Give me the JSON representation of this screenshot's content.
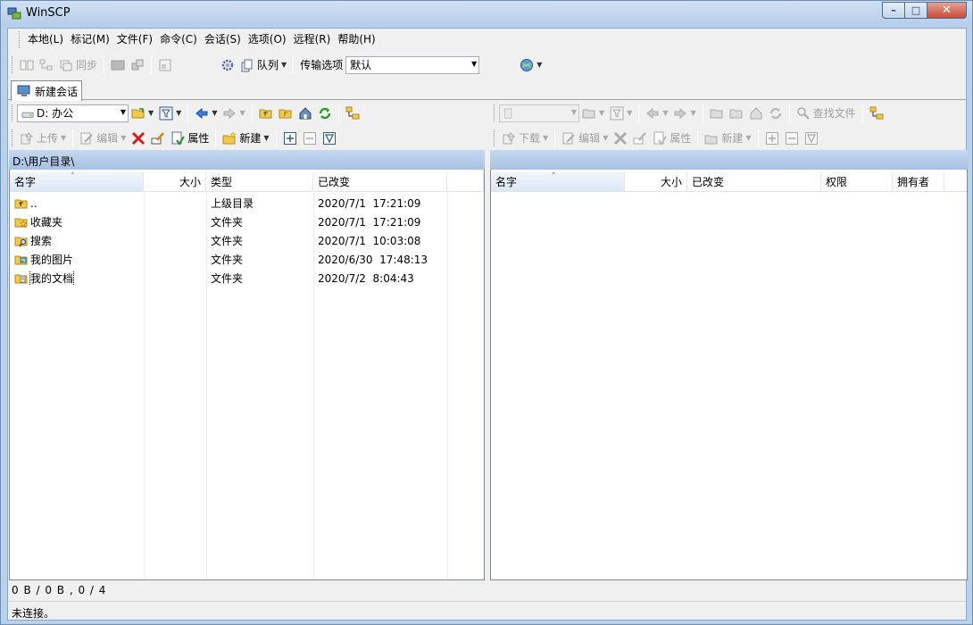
{
  "window": {
    "title": "WinSCP"
  },
  "menu": [
    "本地(L)",
    "标记(M)",
    "文件(F)",
    "命令(C)",
    "会话(S)",
    "选项(O)",
    "远程(R)",
    "帮助(H)"
  ],
  "toolbar1": {
    "sync_label": "同步",
    "queue_label": "队列",
    "transfer_label": "传输选项",
    "transfer_value": "默认"
  },
  "tabs": {
    "new_session": "新建会话"
  },
  "local_nav": {
    "drive": "D: 办公"
  },
  "local_actions": {
    "upload": "上传",
    "edit": "编辑",
    "properties": "属性",
    "new": "新建"
  },
  "remote_nav": {
    "find": "查找文件"
  },
  "remote_actions": {
    "download": "下载",
    "edit": "编辑",
    "properties": "属性",
    "new": "新建"
  },
  "local_panel": {
    "path": "D:\\用户目录\\",
    "columns": {
      "name": "名字",
      "size": "大小",
      "type": "类型",
      "changed": "已改变"
    },
    "rows": [
      {
        "name": "..",
        "type": "上级目录",
        "date": "2020/7/1",
        "time": "17:21:09",
        "icon": "parent-dir-icon"
      },
      {
        "name": "收藏夹",
        "type": "文件夹",
        "date": "2020/7/1",
        "time": "17:21:09",
        "icon": "favorites-folder-icon"
      },
      {
        "name": "搜索",
        "type": "文件夹",
        "date": "2020/7/1",
        "time": "10:03:08",
        "icon": "search-folder-icon"
      },
      {
        "name": "我的图片",
        "type": "文件夹",
        "date": "2020/6/30",
        "time": "17:48:13",
        "icon": "pictures-folder-icon"
      },
      {
        "name": "我的文档",
        "type": "文件夹",
        "date": "2020/7/2",
        "time": "8:04:43",
        "icon": "documents-folder-icon"
      }
    ]
  },
  "remote_panel": {
    "columns": {
      "name": "名字",
      "size": "大小",
      "changed": "已改变",
      "rights": "权限",
      "owner": "拥有者"
    }
  },
  "status": {
    "selection": "0 B / 0 B , 0 / 4",
    "connection": "未连接。"
  },
  "colors": {
    "accent": "#b9d1ea",
    "path_bar": "#a8c2e2",
    "close_button": "#c74c37"
  }
}
